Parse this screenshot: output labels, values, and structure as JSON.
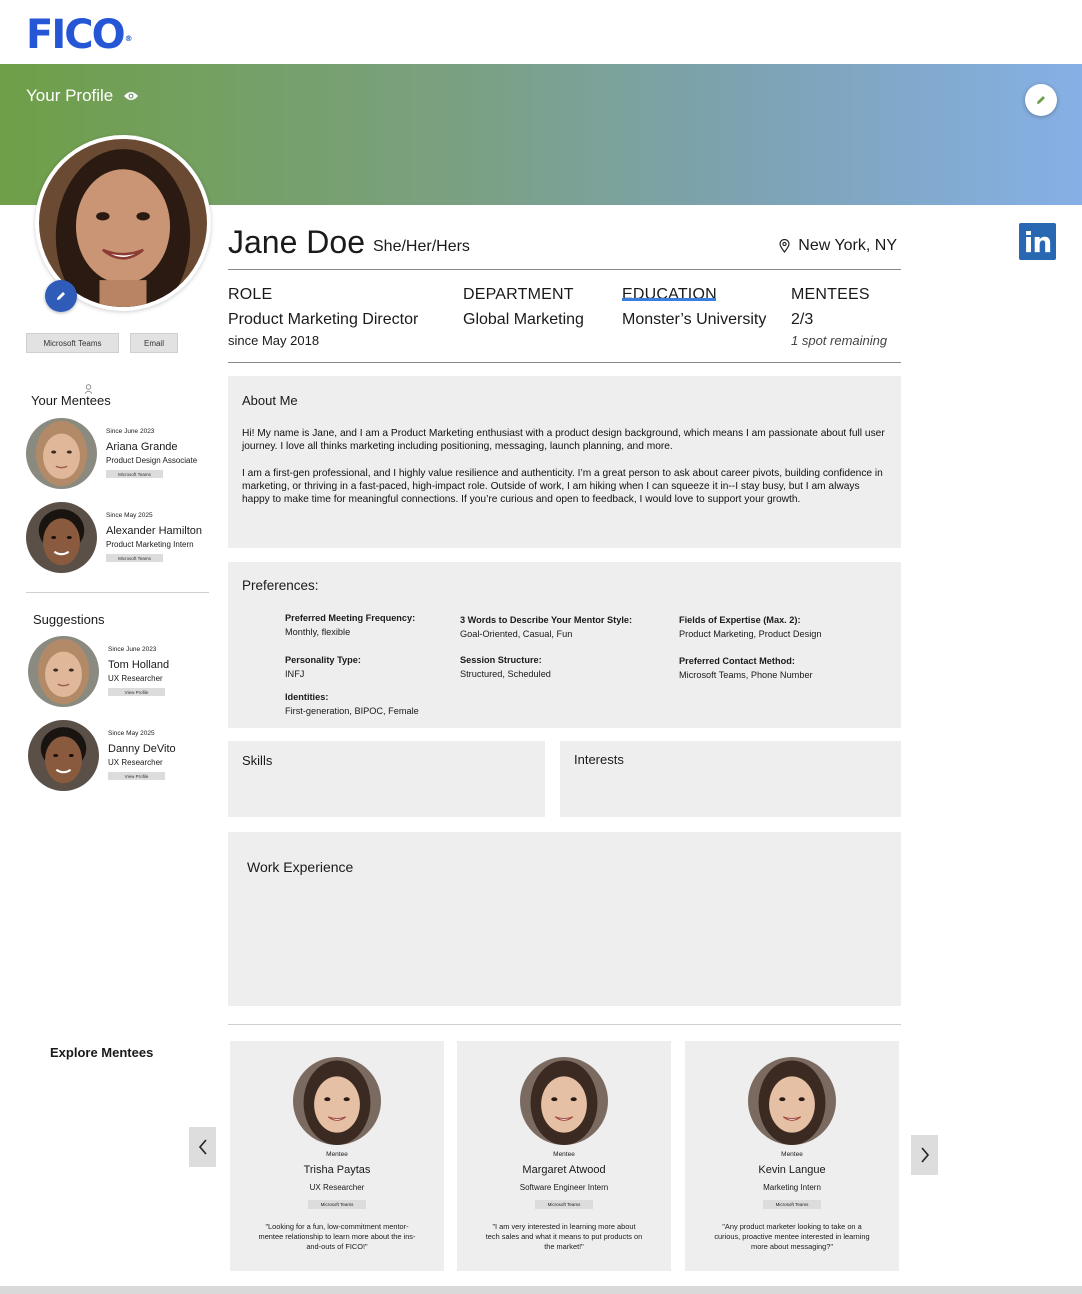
{
  "brand": {
    "logo_text": "FICO",
    "logo_mark": "®"
  },
  "banner": {
    "title": "Your Profile",
    "gradient": [
      "#6f9f48",
      "#86b0e6"
    ]
  },
  "profile": {
    "name": "Jane Doe",
    "pronouns": "She/Her/Hers",
    "location": "New York, NY",
    "contact_buttons": [
      "Microsoft Teams",
      "Email"
    ],
    "linkedin_label": "in",
    "facts": {
      "role": {
        "label": "ROLE",
        "value": "Product Marketing Director",
        "sub": "since May 2018"
      },
      "department": {
        "label": "DEPARTMENT",
        "value": "Global Marketing"
      },
      "education": {
        "label": "EDUCATION",
        "value": "Monster’s University"
      },
      "mentees": {
        "label": "MENTEES",
        "value": "2/3",
        "sub": "1 spot remaining"
      }
    }
  },
  "about": {
    "title": "About Me",
    "paragraphs": [
      "Hi! My name is Jane, and I am a Product Marketing enthusiast with a product design background, which means I am passionate about full user journey. I love all thinks marketing including positioning, messaging, launch planning, and more.",
      "I am a first-gen professional, and I highly value resilience and authenticity. I’m a great person to ask about career pivots, building confidence in marketing, or thriving in a fast-paced, high-impact role. Outside of work, I am hiking when I can squeeze it in--I stay busy, but I am always happy to make time for meaningful connections. If you’re curious and open to feedback, I would love to support your growth."
    ]
  },
  "preferences": {
    "title": "Preferences:",
    "items": [
      {
        "label": "Preferred Meeting Frequency:",
        "value": "Monthly, flexible"
      },
      {
        "label": "3 Words to Describe Your Mentor Style:",
        "value": "Goal-Oriented, Casual, Fun"
      },
      {
        "label": "Fields of Expertise (Max. 2):",
        "value": "Product Marketing, Product Design"
      },
      {
        "label": "Personality Type:",
        "value": "INFJ"
      },
      {
        "label": "Session Structure:",
        "value": "Structured, Scheduled"
      },
      {
        "label": "Preferred Contact Method:",
        "value": "Microsoft Teams, Phone Number"
      },
      {
        "label": "Identities:",
        "value": "First-generation, BIPOC, Female"
      }
    ]
  },
  "sections": {
    "skills": "Skills",
    "interests": "Interests",
    "work_experience": "Work Experience"
  },
  "sidebar": {
    "mentees_title": "Your Mentees",
    "mentees": [
      {
        "since": "Since June 2023",
        "name": "Ariana Grande",
        "role": "Product Design Associate",
        "tag": "Microsoft Teams"
      },
      {
        "since": "Since May 2025",
        "name": "Alexander Hamilton",
        "role": "Product Marketing Intern",
        "tag": "Microsoft Teams"
      }
    ],
    "suggestions_title": "Suggestions",
    "suggestions": [
      {
        "since": "Since June 2023",
        "name": "Tom Holland",
        "role": "UX Researcher",
        "tag": "View Profile"
      },
      {
        "since": "Since May 2025",
        "name": "Danny DeVito",
        "role": "UX Researcher",
        "tag": "View Profile"
      }
    ]
  },
  "explore": {
    "title": "Explore Mentees",
    "cards": [
      {
        "label": "Mentee",
        "name": "Trisha Paytas",
        "role": "UX Researcher",
        "tag": "Microsoft Teams",
        "quote": "\"Looking for a fun, low-commitment mentor-mentee relationship to learn more about the ins-and-outs of FICO!\""
      },
      {
        "label": "Mentee",
        "name": "Margaret Atwood",
        "role": "Software Engineer Intern",
        "tag": "Microsoft Teams",
        "quote": "\"I am very interested in learning more about tech sales and what it means to put products on the market!\""
      },
      {
        "label": "Mentee",
        "name": "Kevin Langue",
        "role": "Marketing Intern",
        "tag": "Microsoft Teams",
        "quote": "\"Any product marketer looking to take on a curious, proactive mentee interested in learning more about messaging?\""
      }
    ]
  }
}
